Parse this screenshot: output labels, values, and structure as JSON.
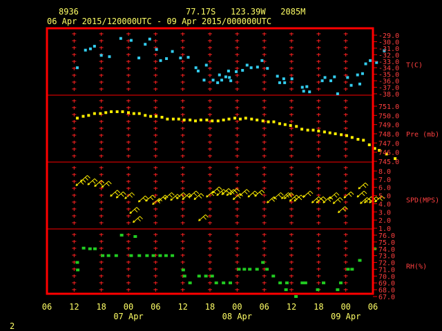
{
  "header": {
    "station_id": "8936",
    "location": "77.17S   123.39W   2085M",
    "period": "06 Apr 2015/120000UTC - 09 Apr 2015/000000UTC",
    "page_number": "2"
  },
  "colors": {
    "frame": "#ff0000",
    "grid": "#ff2020",
    "temperature": "#33ccee",
    "pressure": "#ffee00",
    "wind": "#ffee00",
    "rh": "#22cc22",
    "title_text": "#ffff66"
  },
  "chart_data": {
    "type": "scatter",
    "x_axis": {
      "tick_labels": [
        "06",
        "12",
        "18",
        "00",
        "06",
        "12",
        "18",
        "00",
        "06",
        "12",
        "18",
        "00",
        "06"
      ],
      "date_labels": [
        "07 Apr",
        "08 Apr",
        "09 Apr"
      ],
      "range_hours_from_06Apr_00UTC": [
        6,
        78
      ]
    },
    "panels": [
      {
        "name": "temperature",
        "label": "T(C)",
        "ylim": [
          -38,
          -29
        ],
        "tick_labels": [
          "-29.0",
          "-30.0",
          "-31.0",
          "-32.0",
          "-33.0",
          "-34.0",
          "-35.0",
          "-36.0",
          "-37.0",
          "-38.0"
        ],
        "points": [
          [
            12.7,
            -34.0
          ],
          [
            14.5,
            -31.3
          ],
          [
            15.6,
            -31.1
          ],
          [
            16.5,
            -30.7
          ],
          [
            18.0,
            -32.1
          ],
          [
            19.8,
            -32.3
          ],
          [
            22.3,
            -29.5
          ],
          [
            24.6,
            -29.8
          ],
          [
            26.3,
            -32.5
          ],
          [
            27.7,
            -30.4
          ],
          [
            28.7,
            -29.6
          ],
          [
            30.2,
            -31.2
          ],
          [
            31.1,
            -32.9
          ],
          [
            32.4,
            -32.6
          ],
          [
            33.7,
            -31.5
          ],
          [
            35.5,
            -32.5
          ],
          [
            37.2,
            -32.4
          ],
          [
            38.9,
            -34.0
          ],
          [
            39.4,
            -34.5
          ],
          [
            40.7,
            -35.9
          ],
          [
            41.2,
            -33.6
          ],
          [
            42.7,
            -35.9
          ],
          [
            43.7,
            -36.3
          ],
          [
            44.1,
            -35.1
          ],
          [
            44.6,
            -35.9
          ],
          [
            45.5,
            -35.4
          ],
          [
            46.1,
            -34.5
          ],
          [
            46.3,
            -35.5
          ],
          [
            46.6,
            -36.0
          ],
          [
            47.8,
            -34.6
          ],
          [
            49.2,
            -34.4
          ],
          [
            50.2,
            -33.6
          ],
          [
            51.1,
            -34.0
          ],
          [
            52.5,
            -33.9
          ],
          [
            53.5,
            -32.9
          ],
          [
            54.7,
            -34.1
          ],
          [
            56.9,
            -35.3
          ],
          [
            57.4,
            -36.3
          ],
          [
            58.3,
            -35.7
          ],
          [
            58.5,
            -36.3
          ],
          [
            60.1,
            -35.7
          ],
          [
            62.4,
            -37.0
          ],
          [
            62.7,
            -37.6
          ],
          [
            63.4,
            -36.9
          ],
          [
            64.0,
            -37.7
          ],
          [
            66.8,
            -36.0
          ],
          [
            67.4,
            -35.5
          ],
          [
            68.7,
            -36.0
          ],
          [
            69.5,
            -35.4
          ],
          [
            70.2,
            -38.0
          ],
          [
            72.4,
            -35.5
          ],
          [
            73.2,
            -36.7
          ],
          [
            74.6,
            -35.1
          ],
          [
            75.1,
            -36.5
          ],
          [
            75.7,
            -34.9
          ],
          [
            76.4,
            -33.4
          ],
          [
            77.4,
            -32.9
          ],
          [
            78.8,
            -33.2
          ],
          [
            80.5,
            -31.4
          ]
        ]
      },
      {
        "name": "pressure",
        "label": "Pre (mb)",
        "ylim": [
          745,
          751
        ],
        "tick_labels": [
          "751.0",
          "750.0",
          "749.0",
          "748.0",
          "747.0",
          "746.0",
          "745.0"
        ],
        "points": [
          [
            12.7,
            749.7
          ],
          [
            14.0,
            749.9
          ],
          [
            15.2,
            750.0
          ],
          [
            16.5,
            750.2
          ],
          [
            17.8,
            750.2
          ],
          [
            19.0,
            750.3
          ],
          [
            20.2,
            750.4
          ],
          [
            21.5,
            750.4
          ],
          [
            22.7,
            750.4
          ],
          [
            24.0,
            750.3
          ],
          [
            25.2,
            750.2
          ],
          [
            26.4,
            750.2
          ],
          [
            27.7,
            750.0
          ],
          [
            28.9,
            749.9
          ],
          [
            30.1,
            749.9
          ],
          [
            31.4,
            749.8
          ],
          [
            32.6,
            749.6
          ],
          [
            33.9,
            749.6
          ],
          [
            35.1,
            749.6
          ],
          [
            36.3,
            749.5
          ],
          [
            37.6,
            749.5
          ],
          [
            38.8,
            749.4
          ],
          [
            40.0,
            749.5
          ],
          [
            41.3,
            749.5
          ],
          [
            42.5,
            749.4
          ],
          [
            43.8,
            749.4
          ],
          [
            45.0,
            749.5
          ],
          [
            46.2,
            749.6
          ],
          [
            47.5,
            749.7
          ],
          [
            48.7,
            749.6
          ],
          [
            49.9,
            749.7
          ],
          [
            51.2,
            749.6
          ],
          [
            52.4,
            749.5
          ],
          [
            53.7,
            749.4
          ],
          [
            54.9,
            749.3
          ],
          [
            56.1,
            749.3
          ],
          [
            57.4,
            749.1
          ],
          [
            58.6,
            749.0
          ],
          [
            59.8,
            748.9
          ],
          [
            61.1,
            748.8
          ],
          [
            62.3,
            748.5
          ],
          [
            63.6,
            748.4
          ],
          [
            64.8,
            748.4
          ],
          [
            66.0,
            748.3
          ],
          [
            67.3,
            748.2
          ],
          [
            68.5,
            748.1
          ],
          [
            69.7,
            748.0
          ],
          [
            71.0,
            747.9
          ],
          [
            72.2,
            747.8
          ],
          [
            73.4,
            747.6
          ],
          [
            74.7,
            747.4
          ],
          [
            75.9,
            747.3
          ],
          [
            77.2,
            746.8
          ],
          [
            78.4,
            746.4
          ],
          [
            79.4,
            746.2
          ],
          [
            81.0,
            745.8
          ],
          [
            82.9,
            745.3
          ]
        ]
      },
      {
        "name": "wind",
        "label": "SPD(MPS)",
        "ylim": [
          1,
          8
        ],
        "tick_labels": [
          "8.0",
          "7.0",
          "6.0",
          "5.0",
          "4.0",
          "3.0",
          "2.0",
          "1.0"
        ],
        "barbs": [
          [
            12.4,
            6.2
          ],
          [
            13.4,
            6.7
          ],
          [
            15.0,
            6.3
          ],
          [
            16.5,
            6.1
          ],
          [
            18.1,
            6.0
          ],
          [
            20.0,
            4.9
          ],
          [
            21.3,
            4.7
          ],
          [
            23.2,
            4.6
          ],
          [
            24.3,
            2.8
          ],
          [
            25.0,
            1.7
          ],
          [
            26.2,
            4.2
          ],
          [
            27.8,
            4.3
          ],
          [
            29.3,
            3.9
          ],
          [
            30.6,
            4.3
          ],
          [
            32.0,
            4.6
          ],
          [
            33.3,
            4.4
          ],
          [
            34.6,
            4.6
          ],
          [
            35.9,
            4.5
          ],
          [
            37.4,
            4.8
          ],
          [
            38.5,
            4.5
          ],
          [
            39.5,
            1.9
          ],
          [
            41.2,
            4.8
          ],
          [
            42.5,
            5.3
          ],
          [
            43.5,
            5.0
          ],
          [
            44.6,
            5.1
          ],
          [
            45.7,
            5.0
          ],
          [
            46.4,
            5.1
          ],
          [
            47.1,
            4.5
          ],
          [
            48.6,
            5.0
          ],
          [
            50.4,
            4.8
          ],
          [
            51.9,
            4.9
          ],
          [
            54.6,
            4.1
          ],
          [
            56.1,
            4.6
          ],
          [
            57.8,
            4.6
          ],
          [
            58.4,
            4.6
          ],
          [
            59.6,
            4.3
          ],
          [
            60.6,
            4.3
          ],
          [
            62.6,
            4.8
          ],
          [
            64.5,
            4.1
          ],
          [
            65.5,
            4.1
          ],
          [
            67.0,
            4.1
          ],
          [
            68.4,
            4.6
          ],
          [
            69.2,
            4.0
          ],
          [
            70.3,
            2.9
          ],
          [
            71.6,
            4.7
          ],
          [
            74.5,
            4.8
          ],
          [
            74.8,
            5.8
          ],
          [
            75.2,
            4.0
          ],
          [
            76.1,
            4.1
          ],
          [
            77.2,
            4.1
          ],
          [
            78.4,
            4.2
          ]
        ]
      },
      {
        "name": "relative_humidity",
        "label": "RH(%)",
        "ylim": [
          67,
          76
        ],
        "tick_labels": [
          "76.0",
          "75.0",
          "74.0",
          "73.0",
          "72.0",
          "71.0",
          "70.0",
          "69.0",
          "68.0",
          "67.0"
        ],
        "points": [
          [
            12.7,
            72.0
          ],
          [
            12.8,
            70.9
          ],
          [
            14.1,
            74.1
          ],
          [
            15.5,
            74.0
          ],
          [
            16.6,
            74.0
          ],
          [
            18.3,
            73.0
          ],
          [
            19.6,
            73.0
          ],
          [
            21.3,
            73.0
          ],
          [
            22.5,
            76.0
          ],
          [
            24.6,
            73.0
          ],
          [
            25.5,
            75.8
          ],
          [
            26.4,
            73.0
          ],
          [
            28.1,
            73.0
          ],
          [
            29.5,
            73.0
          ],
          [
            31.0,
            73.0
          ],
          [
            32.3,
            73.0
          ],
          [
            33.7,
            73.0
          ],
          [
            36.1,
            70.9
          ],
          [
            36.4,
            70.0
          ],
          [
            37.6,
            69.0
          ],
          [
            39.6,
            70.0
          ],
          [
            41.1,
            70.0
          ],
          [
            42.5,
            70.0
          ],
          [
            43.4,
            69.0
          ],
          [
            45.0,
            69.0
          ],
          [
            46.5,
            69.0
          ],
          [
            48.4,
            71.0
          ],
          [
            49.6,
            71.0
          ],
          [
            50.8,
            71.0
          ],
          [
            52.4,
            71.0
          ],
          [
            53.7,
            72.0
          ],
          [
            54.6,
            71.0
          ],
          [
            56.0,
            70.0
          ],
          [
            57.5,
            69.0
          ],
          [
            58.8,
            68.0
          ],
          [
            59.0,
            69.0
          ],
          [
            61.0,
            67.0
          ],
          [
            62.4,
            69.0
          ],
          [
            63.1,
            69.0
          ],
          [
            65.8,
            68.0
          ],
          [
            67.1,
            69.0
          ],
          [
            70.2,
            68.0
          ],
          [
            70.9,
            69.0
          ],
          [
            72.5,
            71.0
          ],
          [
            73.4,
            71.0
          ],
          [
            75.1,
            72.3
          ],
          [
            78.4,
            74.0
          ]
        ]
      }
    ]
  }
}
